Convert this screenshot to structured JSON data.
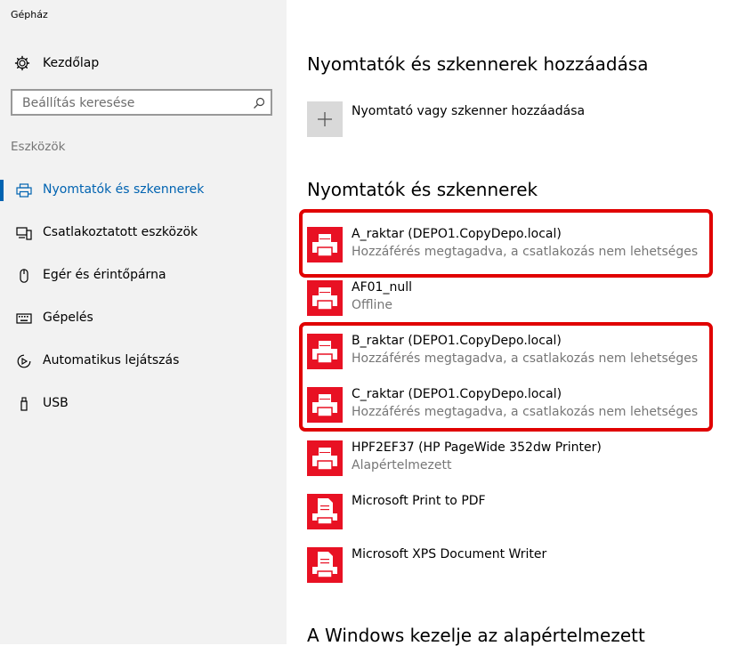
{
  "window": {
    "title": "Gépház"
  },
  "sidebar": {
    "home_label": "Kezdőlap",
    "search_placeholder": "Beállítás keresése",
    "section_label": "Eszközök",
    "items": [
      {
        "label": "Nyomtatók és szkennerek",
        "icon": "printer-icon",
        "active": true
      },
      {
        "label": "Csatlakoztatott eszközök",
        "icon": "devices-icon",
        "active": false
      },
      {
        "label": "Egér és érintőpárna",
        "icon": "mouse-icon",
        "active": false
      },
      {
        "label": "Gépelés",
        "icon": "keyboard-icon",
        "active": false
      },
      {
        "label": "Automatikus lejátszás",
        "icon": "autoplay-icon",
        "active": false
      },
      {
        "label": "USB",
        "icon": "usb-icon",
        "active": false
      }
    ]
  },
  "main": {
    "add_heading": "Nyomtatók és szkennerek hozzáadása",
    "add_button_label": "Nyomtató vagy szkenner hozzáadása",
    "list_heading": "Nyomtatók és szkennerek",
    "printers": [
      {
        "name": "A_raktar (DEPO1.CopyDepo.local)",
        "status": "Hozzáférés megtagadva, a csatlakozás nem lehetséges",
        "icon": "printer-icon"
      },
      {
        "name": "AF01_null",
        "status": "Offline",
        "icon": "printer-icon"
      },
      {
        "name": "B_raktar (DEPO1.CopyDepo.local)",
        "status": "Hozzáférés megtagadva, a csatlakozás nem lehetséges",
        "icon": "printer-icon"
      },
      {
        "name": "C_raktar (DEPO1.CopyDepo.local)",
        "status": "Hozzáférés megtagadva, a csatlakozás nem lehetséges",
        "icon": "printer-icon"
      },
      {
        "name": "HPF2EF37 (HP PageWide 352dw Printer)",
        "status": "Alapértelmezett",
        "icon": "printer-icon"
      },
      {
        "name": "Microsoft Print to PDF",
        "status": "",
        "icon": "document-printer-icon"
      },
      {
        "name": "Microsoft XPS Document Writer",
        "status": "",
        "icon": "document-printer-icon"
      }
    ],
    "bottom_heading": "A Windows kezelje az alapértelmezett"
  },
  "colors": {
    "accent": "#0063b1",
    "printer_tile": "#e81123",
    "highlight": "#e00000"
  }
}
